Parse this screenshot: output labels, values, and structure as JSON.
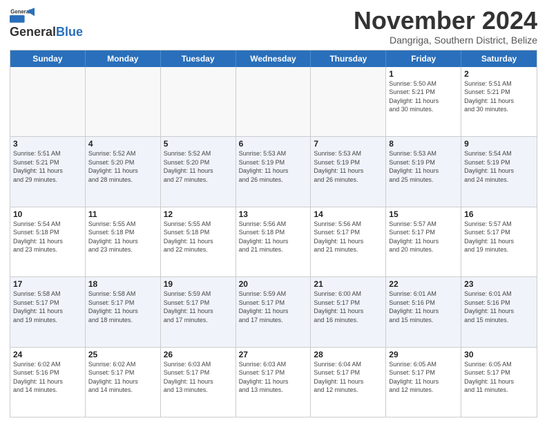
{
  "header": {
    "logo_line1": "General",
    "logo_line2": "Blue",
    "month_title": "November 2024",
    "location": "Dangriga, Southern District, Belize"
  },
  "weekdays": [
    "Sunday",
    "Monday",
    "Tuesday",
    "Wednesday",
    "Thursday",
    "Friday",
    "Saturday"
  ],
  "weeks": [
    [
      {
        "day": "",
        "info": "",
        "empty": true
      },
      {
        "day": "",
        "info": "",
        "empty": true
      },
      {
        "day": "",
        "info": "",
        "empty": true
      },
      {
        "day": "",
        "info": "",
        "empty": true
      },
      {
        "day": "",
        "info": "",
        "empty": true
      },
      {
        "day": "1",
        "info": "Sunrise: 5:50 AM\nSunset: 5:21 PM\nDaylight: 11 hours\nand 30 minutes.",
        "empty": false
      },
      {
        "day": "2",
        "info": "Sunrise: 5:51 AM\nSunset: 5:21 PM\nDaylight: 11 hours\nand 30 minutes.",
        "empty": false
      }
    ],
    [
      {
        "day": "3",
        "info": "Sunrise: 5:51 AM\nSunset: 5:21 PM\nDaylight: 11 hours\nand 29 minutes.",
        "empty": false
      },
      {
        "day": "4",
        "info": "Sunrise: 5:52 AM\nSunset: 5:20 PM\nDaylight: 11 hours\nand 28 minutes.",
        "empty": false
      },
      {
        "day": "5",
        "info": "Sunrise: 5:52 AM\nSunset: 5:20 PM\nDaylight: 11 hours\nand 27 minutes.",
        "empty": false
      },
      {
        "day": "6",
        "info": "Sunrise: 5:53 AM\nSunset: 5:19 PM\nDaylight: 11 hours\nand 26 minutes.",
        "empty": false
      },
      {
        "day": "7",
        "info": "Sunrise: 5:53 AM\nSunset: 5:19 PM\nDaylight: 11 hours\nand 26 minutes.",
        "empty": false
      },
      {
        "day": "8",
        "info": "Sunrise: 5:53 AM\nSunset: 5:19 PM\nDaylight: 11 hours\nand 25 minutes.",
        "empty": false
      },
      {
        "day": "9",
        "info": "Sunrise: 5:54 AM\nSunset: 5:19 PM\nDaylight: 11 hours\nand 24 minutes.",
        "empty": false
      }
    ],
    [
      {
        "day": "10",
        "info": "Sunrise: 5:54 AM\nSunset: 5:18 PM\nDaylight: 11 hours\nand 23 minutes.",
        "empty": false
      },
      {
        "day": "11",
        "info": "Sunrise: 5:55 AM\nSunset: 5:18 PM\nDaylight: 11 hours\nand 23 minutes.",
        "empty": false
      },
      {
        "day": "12",
        "info": "Sunrise: 5:55 AM\nSunset: 5:18 PM\nDaylight: 11 hours\nand 22 minutes.",
        "empty": false
      },
      {
        "day": "13",
        "info": "Sunrise: 5:56 AM\nSunset: 5:18 PM\nDaylight: 11 hours\nand 21 minutes.",
        "empty": false
      },
      {
        "day": "14",
        "info": "Sunrise: 5:56 AM\nSunset: 5:17 PM\nDaylight: 11 hours\nand 21 minutes.",
        "empty": false
      },
      {
        "day": "15",
        "info": "Sunrise: 5:57 AM\nSunset: 5:17 PM\nDaylight: 11 hours\nand 20 minutes.",
        "empty": false
      },
      {
        "day": "16",
        "info": "Sunrise: 5:57 AM\nSunset: 5:17 PM\nDaylight: 11 hours\nand 19 minutes.",
        "empty": false
      }
    ],
    [
      {
        "day": "17",
        "info": "Sunrise: 5:58 AM\nSunset: 5:17 PM\nDaylight: 11 hours\nand 19 minutes.",
        "empty": false
      },
      {
        "day": "18",
        "info": "Sunrise: 5:58 AM\nSunset: 5:17 PM\nDaylight: 11 hours\nand 18 minutes.",
        "empty": false
      },
      {
        "day": "19",
        "info": "Sunrise: 5:59 AM\nSunset: 5:17 PM\nDaylight: 11 hours\nand 17 minutes.",
        "empty": false
      },
      {
        "day": "20",
        "info": "Sunrise: 5:59 AM\nSunset: 5:17 PM\nDaylight: 11 hours\nand 17 minutes.",
        "empty": false
      },
      {
        "day": "21",
        "info": "Sunrise: 6:00 AM\nSunset: 5:17 PM\nDaylight: 11 hours\nand 16 minutes.",
        "empty": false
      },
      {
        "day": "22",
        "info": "Sunrise: 6:01 AM\nSunset: 5:16 PM\nDaylight: 11 hours\nand 15 minutes.",
        "empty": false
      },
      {
        "day": "23",
        "info": "Sunrise: 6:01 AM\nSunset: 5:16 PM\nDaylight: 11 hours\nand 15 minutes.",
        "empty": false
      }
    ],
    [
      {
        "day": "24",
        "info": "Sunrise: 6:02 AM\nSunset: 5:16 PM\nDaylight: 11 hours\nand 14 minutes.",
        "empty": false
      },
      {
        "day": "25",
        "info": "Sunrise: 6:02 AM\nSunset: 5:17 PM\nDaylight: 11 hours\nand 14 minutes.",
        "empty": false
      },
      {
        "day": "26",
        "info": "Sunrise: 6:03 AM\nSunset: 5:17 PM\nDaylight: 11 hours\nand 13 minutes.",
        "empty": false
      },
      {
        "day": "27",
        "info": "Sunrise: 6:03 AM\nSunset: 5:17 PM\nDaylight: 11 hours\nand 13 minutes.",
        "empty": false
      },
      {
        "day": "28",
        "info": "Sunrise: 6:04 AM\nSunset: 5:17 PM\nDaylight: 11 hours\nand 12 minutes.",
        "empty": false
      },
      {
        "day": "29",
        "info": "Sunrise: 6:05 AM\nSunset: 5:17 PM\nDaylight: 11 hours\nand 12 minutes.",
        "empty": false
      },
      {
        "day": "30",
        "info": "Sunrise: 6:05 AM\nSunset: 5:17 PM\nDaylight: 11 hours\nand 11 minutes.",
        "empty": false
      }
    ]
  ]
}
